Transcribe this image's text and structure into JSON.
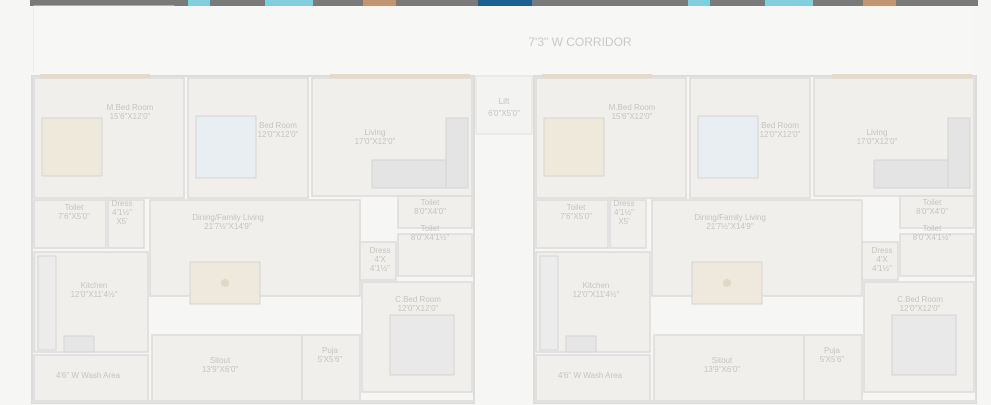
{
  "corridor": {
    "label": "7'3\" W CORRIDOR"
  },
  "lift": {
    "name": "Lift",
    "size": "6'0\"X5'0\""
  },
  "units": [
    {
      "rooms": [
        {
          "key": "mbed",
          "name": "M.Bed Room",
          "size": "15'6\"X12'0\""
        },
        {
          "key": "bed",
          "name": "Bed Room",
          "size": "12'0\"X12'0\""
        },
        {
          "key": "living",
          "name": "Living",
          "size": "17'0\"X12'0\""
        },
        {
          "key": "toilet1",
          "name": "Toilet",
          "size": "7'6\"X5'0\""
        },
        {
          "key": "dress1",
          "name": "Dress",
          "size": "4'1½\"\nX5'"
        },
        {
          "key": "dining",
          "name": "Dining/Family Living",
          "size": "21'7½\"X14'9\""
        },
        {
          "key": "toilet2",
          "name": "Toilet",
          "size": "8'0\"X4'0\""
        },
        {
          "key": "dress2",
          "name": "Dress",
          "size": "4'X\n4'1½\""
        },
        {
          "key": "toilet3",
          "name": "Toilet",
          "size": "8'0\"X4'1½\""
        },
        {
          "key": "kitchen",
          "name": "Kitchen",
          "size": "12'0\"X11'4½\""
        },
        {
          "key": "cbed",
          "name": "C.Bed Room",
          "size": "12'0\"X12'0\""
        },
        {
          "key": "wash",
          "name": "",
          "size": "4'6\" W Wash Area"
        },
        {
          "key": "sitout",
          "name": "Sitout",
          "size": "13'9\"X6'0\""
        },
        {
          "key": "puja",
          "name": "Puja",
          "size": "5'X5'6\""
        }
      ]
    },
    {
      "rooms": [
        {
          "key": "mbed",
          "name": "M.Bed Room",
          "size": "15'6\"X12'0\""
        },
        {
          "key": "bed",
          "name": "Bed Room",
          "size": "12'0\"X12'0\""
        },
        {
          "key": "living",
          "name": "Living",
          "size": "17'0\"X12'0\""
        },
        {
          "key": "toilet1",
          "name": "Toilet",
          "size": "7'6\"X5'0\""
        },
        {
          "key": "dress1",
          "name": "Dress",
          "size": "4'1½\"\nX5'"
        },
        {
          "key": "dining",
          "name": "Dining/Family Living",
          "size": "21'7½\"X14'9\""
        },
        {
          "key": "toilet2",
          "name": "Toilet",
          "size": "8'0\"X4'0\""
        },
        {
          "key": "dress2",
          "name": "Dress",
          "size": "4'X\n4'1½\""
        },
        {
          "key": "toilet3",
          "name": "Toilet",
          "size": "8'0\"X4'1½\""
        },
        {
          "key": "kitchen",
          "name": "Kitchen",
          "size": "12'0\"X11'4½\""
        },
        {
          "key": "cbed",
          "name": "C.Bed Room",
          "size": "12'0\"X12'0\""
        },
        {
          "key": "wash",
          "name": "",
          "size": "4'6\" W Wash Area"
        },
        {
          "key": "sitout",
          "name": "Sitout",
          "size": "13'9\"X6'0\""
        },
        {
          "key": "puja",
          "name": "Puja",
          "size": "5'X5'6\""
        }
      ]
    }
  ],
  "colors": {
    "top_band": "#7a7a7a",
    "wall": "#dcdcdc",
    "window_blue": "#7fd0dc",
    "lift_blue": "#1f5f8b",
    "door_orange": "#e0a070",
    "floor_tile": "#f1efec",
    "furniture": "#d4d4d4",
    "text": "#c4c4c4"
  }
}
